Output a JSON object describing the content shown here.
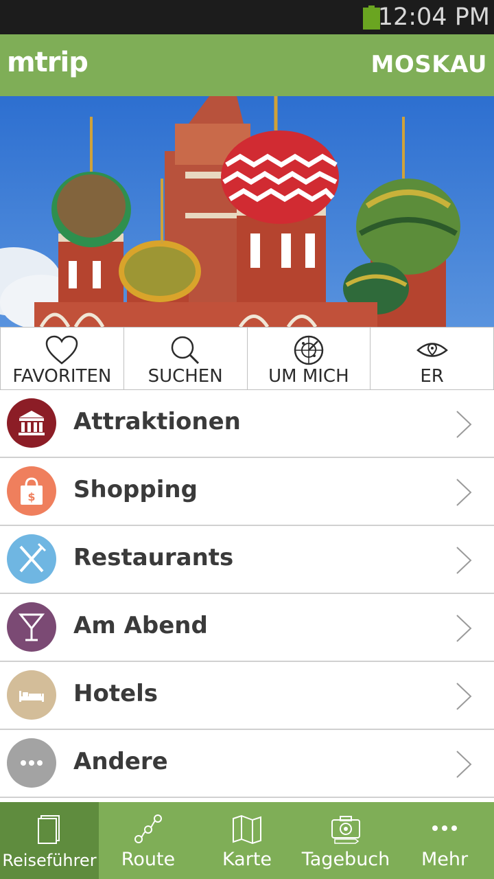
{
  "status_bar": {
    "time": "12:04 PM",
    "battery_icon": "battery-full-icon",
    "battery_color": "#6aa521"
  },
  "app_bar": {
    "logo": "mtrip",
    "city": "MOSKAU",
    "color": "#7fae57"
  },
  "hero": {
    "image": "St.-Basilius-Kathedrale photo (onion domes)"
  },
  "quick_actions": [
    {
      "label": "FAVORITEN",
      "icon": "heart-icon"
    },
    {
      "label": "SUCHEN",
      "icon": "search-icon"
    },
    {
      "label": "UM MICH",
      "icon": "radar-icon"
    },
    {
      "label": "ER",
      "icon": "eye-pin-icon"
    }
  ],
  "categories": [
    {
      "label": "Attraktionen",
      "icon": "museum-icon",
      "color": "#8c1d26"
    },
    {
      "label": "Shopping",
      "icon": "shopping-bag-icon",
      "color": "#ef7f5d"
    },
    {
      "label": "Restaurants",
      "icon": "fork-knife-icon",
      "color": "#6fb6e2"
    },
    {
      "label": "Am Abend",
      "icon": "cocktail-icon",
      "color": "#7b4a74"
    },
    {
      "label": "Hotels",
      "icon": "bed-icon",
      "color": "#d3bd99"
    },
    {
      "label": "Andere",
      "icon": "more-dots-icon",
      "color": "#a3a3a3"
    }
  ],
  "tabs": [
    {
      "label": "Reiseführer",
      "icon": "guidebook-icon",
      "active": true
    },
    {
      "label": "Route",
      "icon": "route-icon",
      "active": false
    },
    {
      "label": "Karte",
      "icon": "map-icon",
      "active": false
    },
    {
      "label": "Tagebuch",
      "icon": "camera-icon",
      "active": false
    },
    {
      "label": "Mehr",
      "icon": "more-dots-icon",
      "active": false
    }
  ],
  "colors": {
    "accent": "#7fae57",
    "accent_dark": "#5f8c3e",
    "text": "#3a3a3a"
  }
}
